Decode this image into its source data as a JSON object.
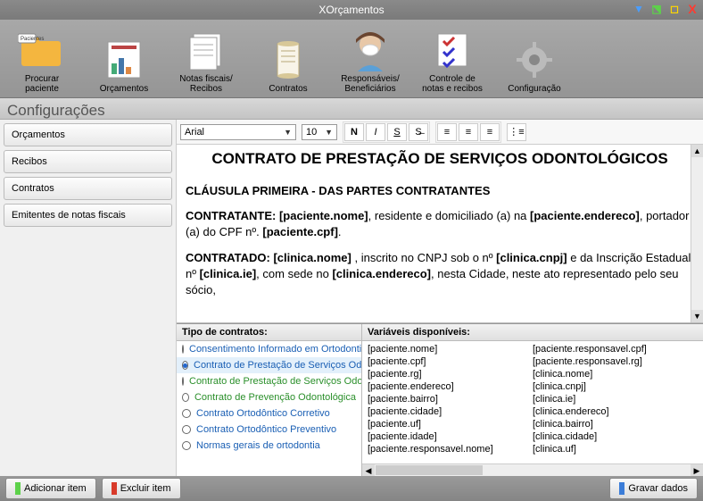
{
  "window": {
    "title": "XOrçamentos"
  },
  "toolbar": [
    {
      "name": "procurar-paciente",
      "label": "Procurar paciente"
    },
    {
      "name": "orcamentos",
      "label": "Orçamentos"
    },
    {
      "name": "notas-fiscais",
      "label": "Notas fiscais/\nRecibos"
    },
    {
      "name": "contratos",
      "label": "Contratos"
    },
    {
      "name": "responsaveis",
      "label": "Responsáveis/\nBeneficiários"
    },
    {
      "name": "controle-notas",
      "label": "Controle de notas e recibos"
    },
    {
      "name": "configuracao",
      "label": "Configuração"
    }
  ],
  "sectionTitle": "Configurações",
  "sidebar": {
    "items": [
      {
        "label": "Orçamentos"
      },
      {
        "label": "Recibos"
      },
      {
        "label": "Contratos"
      },
      {
        "label": "Emitentes de notas fiscais"
      }
    ]
  },
  "editor": {
    "font": "Arial",
    "size": "10"
  },
  "document": {
    "title": "CONTRATO DE PRESTAÇÃO DE SERVIÇOS ODONTOLÓGICOS",
    "clause1": "CLÁUSULA PRIMEIRA - DAS PARTES CONTRATANTES",
    "p1_a": "CONTRATANTE: ",
    "p1_b": "[paciente.nome]",
    "p1_c": ", residente e domiciliado (a) na ",
    "p1_d": "[paciente.endereco]",
    "p1_e": ", portador (a) do CPF nº. ",
    "p1_f": "[paciente.cpf]",
    "p1_g": ".",
    "p2_a": "CONTRATADO: ",
    "p2_b": "[clinica.nome]",
    "p2_c": " , inscrito no CNPJ sob o nº ",
    "p2_d": "[clinica.cnpj]",
    "p2_e": "  e da Inscrição Estadual nº ",
    "p2_f": "[clinica.ie]",
    "p2_g": ", com sede no ",
    "p2_h": "[clinica.endereco]",
    "p2_i": ", nesta Cidade, neste ato representado pelo seu sócio,"
  },
  "contractsHeader": "Tipo de contratos:",
  "contracts": [
    {
      "label": "Consentimento Informado em Ortodontia",
      "cls": "blue-link",
      "selected": false
    },
    {
      "label": "Contrato de Prestação de Serviços Odo",
      "cls": "blue-link",
      "selected": true
    },
    {
      "label": "Contrato de Prestação de Serviços Odo",
      "cls": "green-link",
      "selected": false
    },
    {
      "label": "Contrato de Prevenção Odontológica",
      "cls": "green-link",
      "selected": false
    },
    {
      "label": "Contrato Ortodôntico Corretivo",
      "cls": "blue-link",
      "selected": false
    },
    {
      "label": "Contrato Ortodôntico Preventivo",
      "cls": "blue-link",
      "selected": false
    },
    {
      "label": "Normas gerais de ortodontia",
      "cls": "blue-link",
      "selected": false
    }
  ],
  "varsHeader": "Variáveis disponíveis:",
  "vars": {
    "col1": [
      "[paciente.nome]",
      "[paciente.cpf]",
      "[paciente.rg]",
      "[paciente.endereco]",
      "[paciente.bairro]",
      "[paciente.cidade]",
      "[paciente.uf]",
      "[paciente.idade]",
      "[paciente.responsavel.nome]"
    ],
    "col2": [
      "[paciente.responsavel.cpf]",
      "[paciente.responsavel.rg]",
      "[clinica.nome]",
      "[clinica.cnpj]",
      "[clinica.ie]",
      "[clinica.endereco]",
      "[clinica.bairro]",
      "[clinica.cidade]",
      "[clinica.uf]"
    ]
  },
  "footer": {
    "add": "Adicionar item",
    "del": "Excluir item",
    "save": "Gravar dados"
  }
}
